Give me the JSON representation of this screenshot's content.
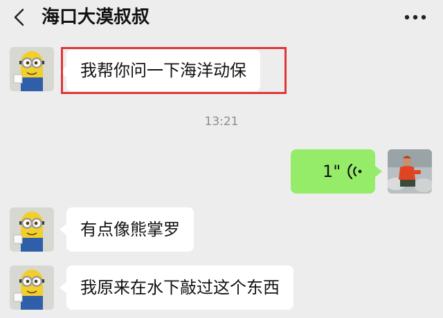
{
  "header": {
    "title": "海口大漠叔叔",
    "back_icon": "chevron-left-icon",
    "more_icon": "more-dots-icon"
  },
  "messages": [
    {
      "sender": "other",
      "type": "text",
      "text": "我帮你问一下海洋动保",
      "highlighted": true
    },
    {
      "type": "timestamp",
      "text": "13:21"
    },
    {
      "sender": "self",
      "type": "voice",
      "text": "1\""
    },
    {
      "sender": "other",
      "type": "text",
      "text": "有点像熊掌罗"
    },
    {
      "sender": "other",
      "type": "text",
      "text": "我原来在水下敲过这个东西"
    }
  ],
  "colors": {
    "background": "#ededed",
    "incoming_bubble": "#ffffff",
    "outgoing_bubble": "#95ec69",
    "highlight_border": "#e03436",
    "timestamp_text": "#8c8c8c"
  }
}
